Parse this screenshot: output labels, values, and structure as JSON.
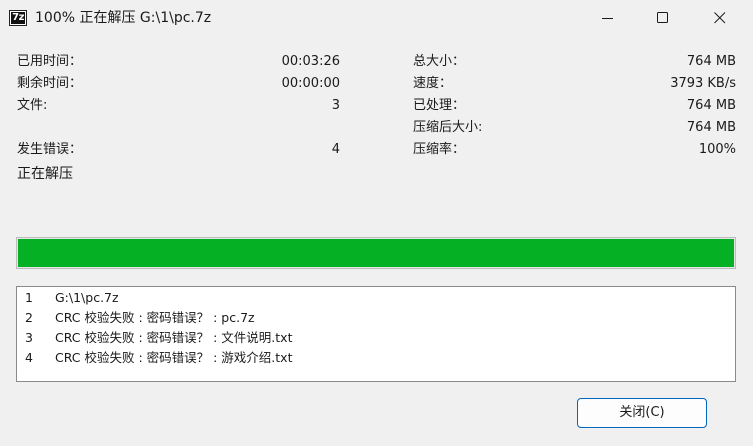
{
  "window": {
    "title": "100% 正在解压 G:\\1\\pc.7z",
    "app_icon_text": "7z"
  },
  "stats_left": {
    "elapsed_label": "已用时间：",
    "elapsed_value": "00:03:26",
    "remaining_label": "剩余时间：",
    "remaining_value": "00:00:00",
    "files_label": "文件:",
    "files_value": "3",
    "errors_label": "发生错误：",
    "errors_value": "4",
    "status_text": "正在解压"
  },
  "stats_right": {
    "total_size_label": "总大小：",
    "total_size_value": "764 MB",
    "speed_label": "速度：",
    "speed_value": "3793 KB/s",
    "processed_label": "已处理：",
    "processed_value": "764 MB",
    "compressed_size_label": "压缩后大小:",
    "compressed_size_value": "764 MB",
    "ratio_label": "压缩率：",
    "ratio_value": "100%"
  },
  "progress": {
    "fraction": 1.0,
    "color": "#06b025"
  },
  "log": {
    "rows": [
      {
        "num": "1",
        "text": "G:\\1\\pc.7z"
      },
      {
        "num": "2",
        "text": "CRC 校验失败 : 密码错误？ : pc.7z"
      },
      {
        "num": "3",
        "text": "CRC 校验失败 : 密码错误？ : 文件说明.txt"
      },
      {
        "num": "4",
        "text": "CRC 校验失败 : 密码错误？ : 游戏介绍.txt"
      }
    ]
  },
  "buttons": {
    "close_label": "关闭(C)"
  },
  "colors": {
    "accent_border": "#0067c0",
    "background": "#f0f0f0"
  }
}
